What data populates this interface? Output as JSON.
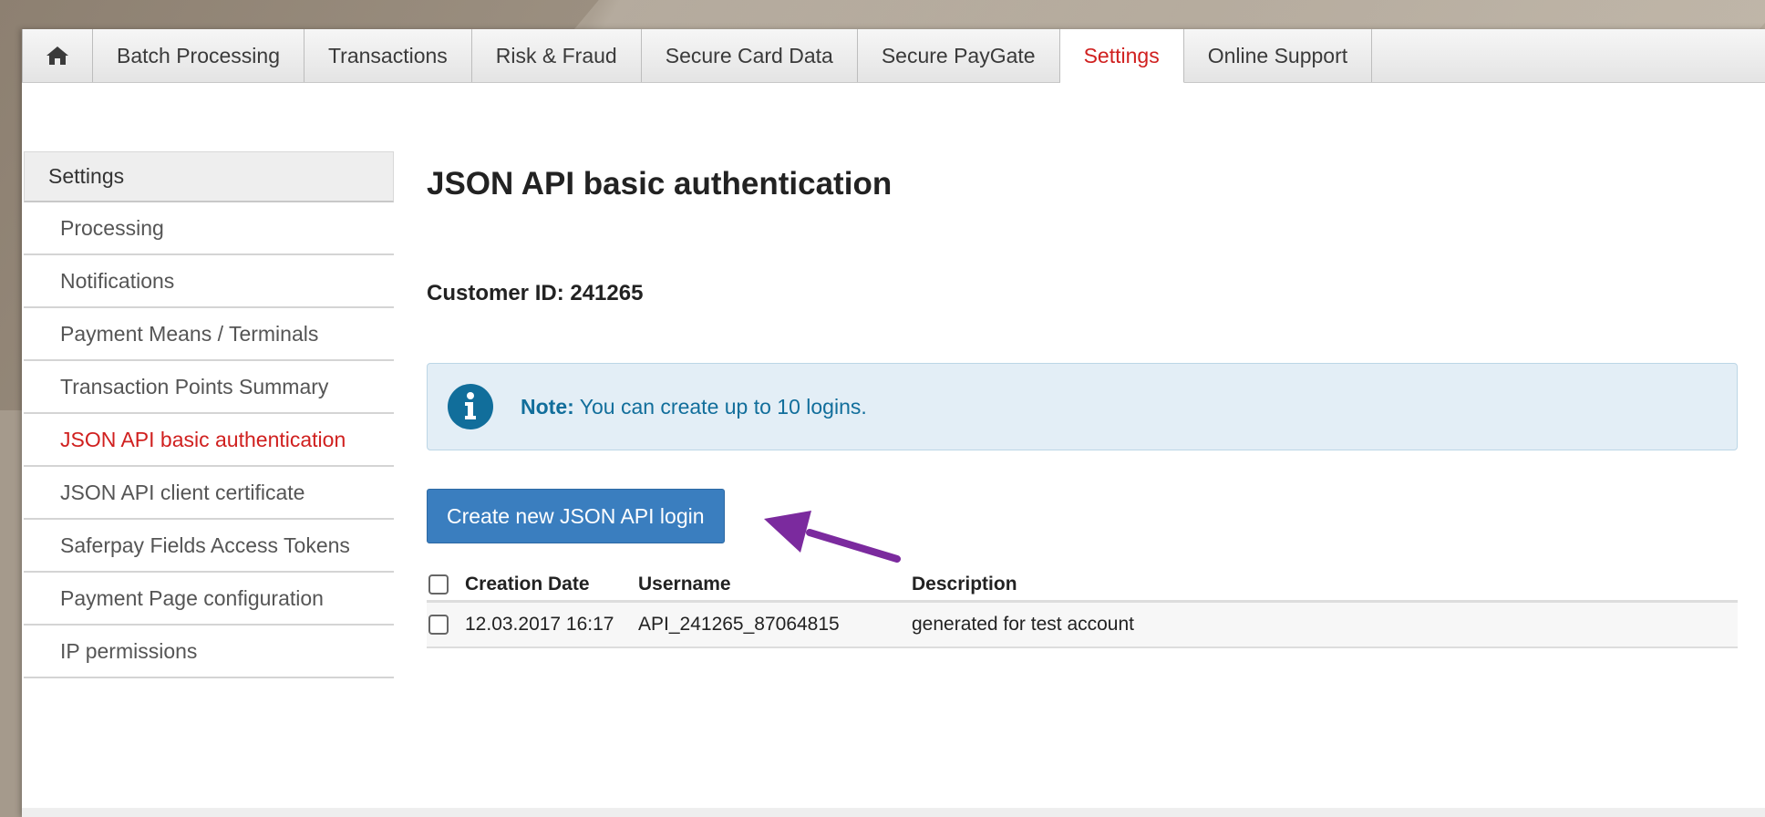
{
  "nav": {
    "home_icon": "home-icon",
    "tabs": [
      {
        "label": "Batch Processing"
      },
      {
        "label": "Transactions"
      },
      {
        "label": "Risk & Fraud"
      },
      {
        "label": "Secure Card Data"
      },
      {
        "label": "Secure PayGate"
      },
      {
        "label": "Settings",
        "active": true
      },
      {
        "label": "Online Support"
      }
    ]
  },
  "sidebar": {
    "header": "Settings",
    "items": [
      {
        "label": "Processing"
      },
      {
        "label": "Notifications"
      },
      {
        "label": "Payment Means / Terminals"
      },
      {
        "label": "Transaction Points Summary"
      },
      {
        "label": "JSON API basic authentication",
        "active": true
      },
      {
        "label": "JSON API client certificate"
      },
      {
        "label": "Saferpay Fields Access Tokens"
      },
      {
        "label": "Payment Page configuration"
      },
      {
        "label": "IP permissions"
      }
    ]
  },
  "main": {
    "title": "JSON API basic authentication",
    "customer_id": "Customer ID: 241265",
    "note": {
      "icon": "info-icon",
      "label": "Note:",
      "text": " You can create up to 10 logins."
    },
    "create_button": "Create new JSON API login",
    "table": {
      "headers": [
        "Creation Date",
        "Username",
        "Description"
      ],
      "rows": [
        [
          "12.03.2017 16:17",
          "API_241265_87064815",
          "generated for test account"
        ]
      ]
    }
  },
  "colors": {
    "accent_red": "#d0201f",
    "button_blue": "#3a7ebf",
    "note_text": "#116e9b",
    "annotation_arrow": "#7b2a9e"
  }
}
